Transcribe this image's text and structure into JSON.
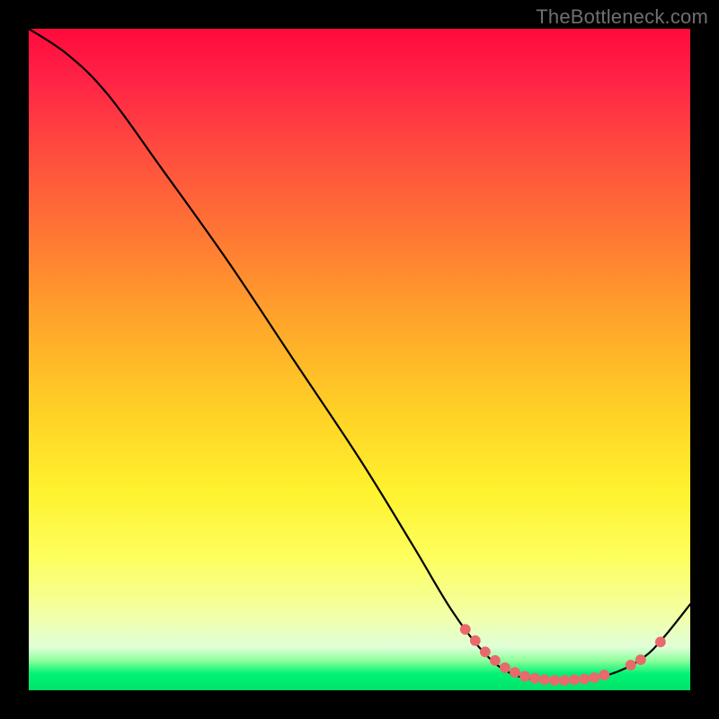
{
  "watermark": "TheBottleneck.com",
  "colors": {
    "dot": "#e86a6a",
    "curve": "#000000"
  },
  "chart_data": {
    "type": "line",
    "title": "",
    "xlabel": "",
    "ylabel": "",
    "xlim": [
      0,
      100
    ],
    "ylim": [
      0,
      100
    ],
    "grid": false,
    "legend": false,
    "curve": [
      {
        "x": 0,
        "y": 100
      },
      {
        "x": 6,
        "y": 96
      },
      {
        "x": 12,
        "y": 90
      },
      {
        "x": 20,
        "y": 79
      },
      {
        "x": 30,
        "y": 65
      },
      {
        "x": 40,
        "y": 50
      },
      {
        "x": 50,
        "y": 35
      },
      {
        "x": 58,
        "y": 22
      },
      {
        "x": 64,
        "y": 12
      },
      {
        "x": 69,
        "y": 5.5
      },
      {
        "x": 73,
        "y": 2.5
      },
      {
        "x": 77,
        "y": 1.6
      },
      {
        "x": 81,
        "y": 1.5
      },
      {
        "x": 85,
        "y": 1.8
      },
      {
        "x": 89,
        "y": 2.8
      },
      {
        "x": 93,
        "y": 5.0
      },
      {
        "x": 96,
        "y": 8.0
      },
      {
        "x": 100,
        "y": 13
      }
    ],
    "points": [
      {
        "x": 66,
        "y": 9.2
      },
      {
        "x": 67.5,
        "y": 7.5
      },
      {
        "x": 69,
        "y": 5.8
      },
      {
        "x": 70.5,
        "y": 4.5
      },
      {
        "x": 72,
        "y": 3.4
      },
      {
        "x": 73.5,
        "y": 2.7
      },
      {
        "x": 75,
        "y": 2.1
      },
      {
        "x": 76.5,
        "y": 1.8
      },
      {
        "x": 78,
        "y": 1.6
      },
      {
        "x": 79.5,
        "y": 1.5
      },
      {
        "x": 81,
        "y": 1.5
      },
      {
        "x": 82.5,
        "y": 1.6
      },
      {
        "x": 84,
        "y": 1.7
      },
      {
        "x": 85.5,
        "y": 1.9
      },
      {
        "x": 87,
        "y": 2.3
      },
      {
        "x": 91,
        "y": 3.8
      },
      {
        "x": 92.5,
        "y": 4.6
      },
      {
        "x": 95.5,
        "y": 7.3
      }
    ]
  }
}
